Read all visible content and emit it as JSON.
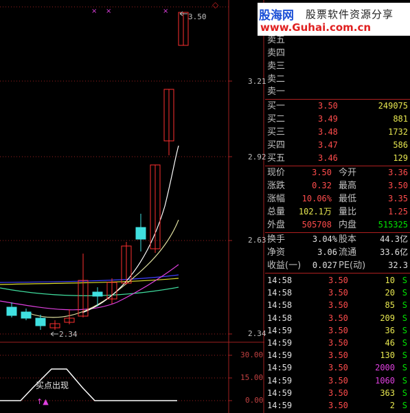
{
  "watermark": {
    "logo": "股海网",
    "tagline": "股票软件资源分享",
    "url": "www.Guhai.com.cn"
  },
  "chart": {
    "price_labels": [
      "3.21",
      "2.92",
      "2.63",
      "2.34"
    ],
    "high_label": "3.50",
    "low_label": "2.34",
    "indicator_labels": [
      "30.00",
      "15.00",
      "0.00"
    ],
    "signal_text": "买点出现",
    "signal_arrow": "↑▲",
    "top_markers": [
      "×",
      "×",
      "×"
    ],
    "corner_marker": "◇",
    "colors": {
      "up": "#ff3030",
      "down": "#40e0e0",
      "grid": "#a02020"
    }
  },
  "sell_orders": [
    {
      "label": "卖五"
    },
    {
      "label": "卖四"
    },
    {
      "label": "卖三"
    },
    {
      "label": "卖二"
    },
    {
      "label": "卖一"
    }
  ],
  "buy_orders": [
    {
      "label": "买一",
      "price": "3.50",
      "volume": "249075"
    },
    {
      "label": "买二",
      "price": "3.49",
      "volume": "881"
    },
    {
      "label": "买三",
      "price": "3.48",
      "volume": "1732"
    },
    {
      "label": "买四",
      "price": "3.47",
      "volume": "586"
    },
    {
      "label": "买五",
      "price": "3.46",
      "volume": "129"
    }
  ],
  "quote": [
    {
      "l1": "现价",
      "v1": "3.50",
      "c1": "red",
      "l2": "今开",
      "v2": "3.36",
      "c2": "red"
    },
    {
      "l1": "涨跌",
      "v1": "0.32",
      "c1": "red",
      "l2": "最高",
      "v2": "3.50",
      "c2": "red"
    },
    {
      "l1": "涨幅",
      "v1": "10.06%",
      "c1": "red",
      "l2": "最低",
      "v2": "3.35",
      "c2": "red"
    },
    {
      "l1": "总量",
      "v1": "102.1万",
      "c1": "yellow",
      "l2": "量比",
      "v2": "1.25",
      "c2": "red"
    },
    {
      "l1": "外盘",
      "v1": "505708",
      "c1": "red",
      "l2": "内盘",
      "v2": "515325",
      "c2": "green"
    }
  ],
  "fundamentals": [
    {
      "l1": "换手",
      "v1": "3.04%",
      "l2": "股本",
      "v2": "44.3亿"
    },
    {
      "l1": "净资",
      "v1": "3.06",
      "l2": "流通",
      "v2": "33.6亿"
    },
    {
      "l1": "收益(一)",
      "v1": "0.027",
      "l2": "PE(动)",
      "v2": "32.3"
    }
  ],
  "ticks": [
    {
      "time": "14:58",
      "price": "3.50",
      "vol": "10",
      "vc": "yellow",
      "side": "S"
    },
    {
      "time": "14:58",
      "price": "3.50",
      "vol": "20",
      "vc": "yellow",
      "side": "S"
    },
    {
      "time": "14:58",
      "price": "3.50",
      "vol": "85",
      "vc": "yellow",
      "side": "S"
    },
    {
      "time": "14:58",
      "price": "3.50",
      "vol": "209",
      "vc": "yellow",
      "side": "S"
    },
    {
      "time": "14:59",
      "price": "3.50",
      "vol": "36",
      "vc": "yellow",
      "side": "S"
    },
    {
      "time": "14:59",
      "price": "3.50",
      "vol": "46",
      "vc": "yellow",
      "side": "S"
    },
    {
      "time": "14:59",
      "price": "3.50",
      "vol": "130",
      "vc": "yellow",
      "side": "S"
    },
    {
      "time": "14:59",
      "price": "3.50",
      "vol": "2000",
      "vc": "magenta",
      "side": "S"
    },
    {
      "time": "14:59",
      "price": "3.50",
      "vol": "1060",
      "vc": "magenta",
      "side": "S"
    },
    {
      "time": "14:59",
      "price": "3.50",
      "vol": "363",
      "vc": "yellow",
      "side": "S"
    },
    {
      "time": "14:59",
      "price": "3.50",
      "vol": "2",
      "vc": "yellow",
      "side": "S"
    }
  ]
}
